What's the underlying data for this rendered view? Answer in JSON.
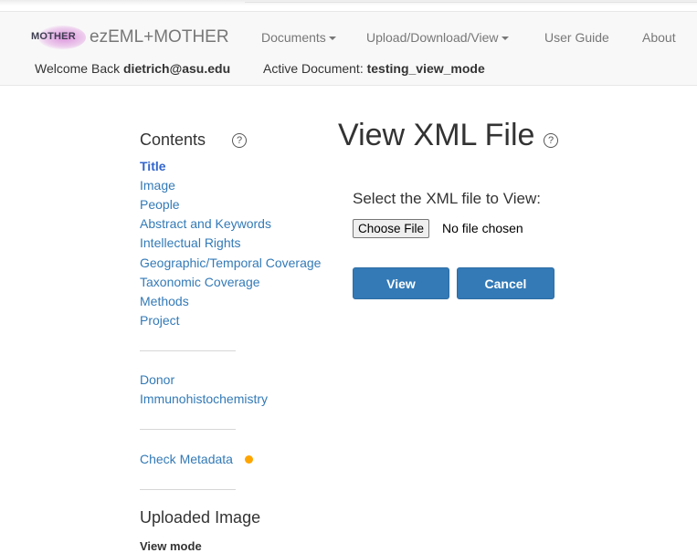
{
  "navbar": {
    "logo_text": "MOTHER",
    "brand": "ezEML+MOTHER",
    "menu": [
      {
        "label": "Documents"
      },
      {
        "label": "Upload/Download/View"
      },
      {
        "label": "User Guide"
      },
      {
        "label": "About"
      }
    ],
    "welcome_prefix": "Welcome Back",
    "user_email": "dietrich@asu.edu",
    "active_doc_prefix": "Active Document:",
    "active_doc_name": "testing_view_mode"
  },
  "sidebar": {
    "heading": "Contents",
    "help_glyph": "?",
    "toc": [
      {
        "label": "Title",
        "current": true
      },
      {
        "label": "Image"
      },
      {
        "label": "People"
      },
      {
        "label": "Abstract and Keywords"
      },
      {
        "label": "Intellectual Rights"
      },
      {
        "label": "Geographic/Temporal Coverage"
      },
      {
        "label": "Taxonomic Coverage"
      },
      {
        "label": "Methods"
      },
      {
        "label": "Project"
      }
    ],
    "extra": [
      {
        "label": "Donor"
      },
      {
        "label": "Immunohistochemistry"
      }
    ],
    "check_metadata": "Check Metadata",
    "status_color": "#ffa500",
    "uploaded_heading": "Uploaded Image",
    "view_mode": "View mode"
  },
  "main": {
    "title": "View XML File",
    "help_glyph": "?",
    "select_label": "Select the XML file to View:",
    "choose_file_label": "Choose File",
    "file_status": "No file chosen",
    "view_button": "View",
    "cancel_button": "Cancel"
  },
  "colors": {
    "accent": "#337ab7",
    "link": "#337ab7",
    "navbar_bg": "#f8f8f8"
  }
}
